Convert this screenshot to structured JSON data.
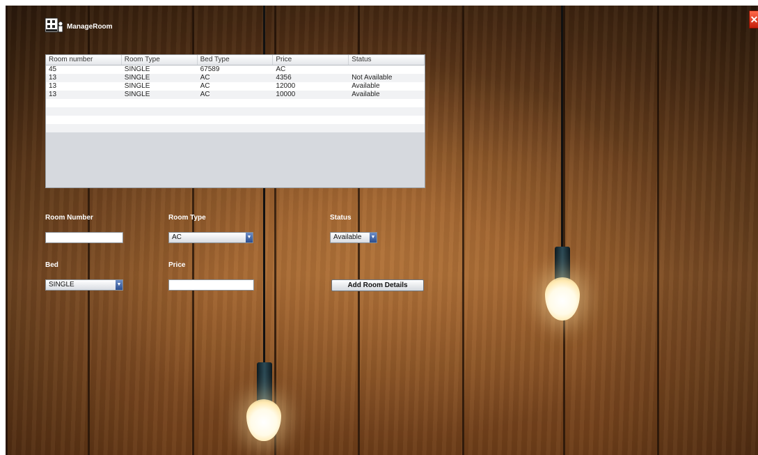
{
  "app": {
    "title": "ManageRoom",
    "close_glyph": "✕"
  },
  "table": {
    "columns": [
      "Room number",
      "Room Type",
      "Bed Type",
      "Price",
      "Status"
    ],
    "rows": [
      [
        "45",
        "SINGLE",
        "67589",
        "AC",
        ""
      ],
      [
        "13",
        "SINGLE",
        "AC",
        "4356",
        "Not Available"
      ],
      [
        "13",
        "SINGLE",
        "AC",
        "12000",
        "Available"
      ],
      [
        "13",
        "SINGLE",
        "AC",
        "10000",
        "Available"
      ]
    ]
  },
  "form": {
    "room_number": {
      "label": "Room Number",
      "value": ""
    },
    "room_type": {
      "label": "Room Type",
      "value": "AC"
    },
    "status": {
      "label": "Status",
      "value": "Available"
    },
    "bed": {
      "label": "Bed",
      "value": "SINGLE"
    },
    "price": {
      "label": "Price",
      "value": ""
    },
    "add_button": "Add Room Details"
  },
  "colors": {
    "accent": "#2c4f8f",
    "close": "#c41e0a"
  }
}
